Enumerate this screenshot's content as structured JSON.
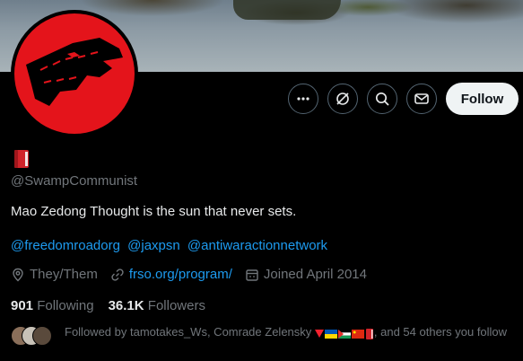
{
  "profile": {
    "handle": "@SwampCommunist",
    "bio": "Mao Zedong Thought is the sun that never sets.",
    "mentions": [
      "@freedomroadorg",
      "@jaxpsn",
      "@antiwaractionnetwork"
    ],
    "pronouns": "They/Them",
    "website": "frso.org/program/",
    "joined": "Joined April 2014",
    "following_count": "901",
    "following_label": "Following",
    "followers_count": "36.1K",
    "followers_label": "Followers",
    "followed_by_prefix": "Followed by tamotakes_Ws, Comrade Zelensky",
    "followed_by_suffix": ", and 54 others you follow"
  },
  "actions": {
    "follow_label": "Follow",
    "icons": [
      "more-icon",
      "grok-icon",
      "search-icon",
      "message-icon"
    ]
  },
  "colors": {
    "accent": "#1d9bf0",
    "muted": "#71767b",
    "avatar_red": "#e4141b"
  }
}
